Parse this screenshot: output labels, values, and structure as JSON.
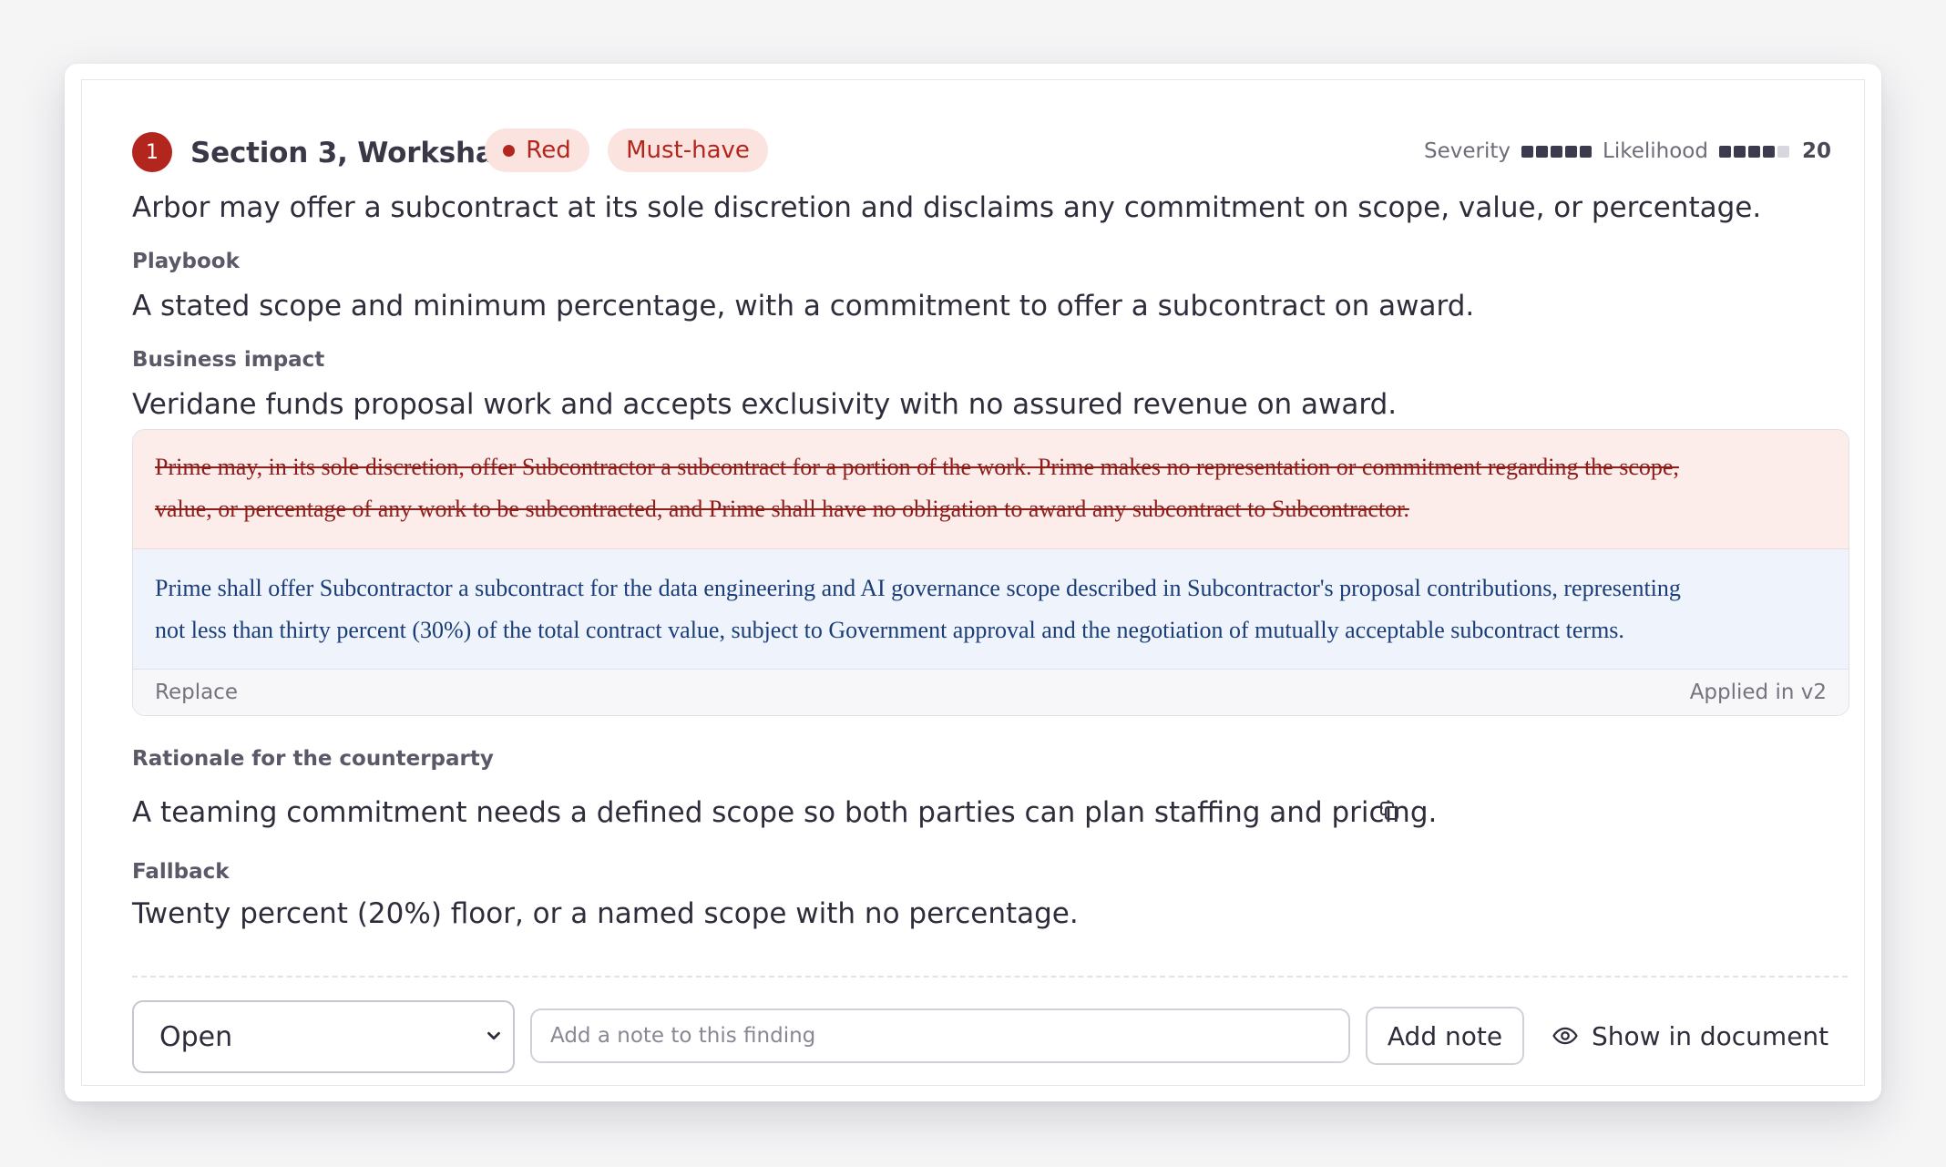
{
  "finding": {
    "number": "1",
    "title": "Section 3, Workshare",
    "rag_label": "Red",
    "priority_label": "Must-have",
    "severity_label": "Severity",
    "severity_level": 5,
    "likelihood_label": "Likelihood",
    "likelihood_level": 4,
    "score": "20",
    "summary": "Arbor may offer a subcontract at its sole discretion and disclaims any commitment on scope, value, or percentage."
  },
  "playbook": {
    "label": "Playbook",
    "text": "A stated scope and minimum percentage, with a commitment to offer a subcontract on award."
  },
  "impact": {
    "label": "Business impact",
    "text": "Veridane funds proposal work and accepts exclusivity with no assured revenue on award."
  },
  "redline": {
    "deleted_line1": "Prime may, in its sole discretion, offer Subcontractor a subcontract for a portion of the work. Prime makes no representation or commitment regarding the scope,",
    "deleted_line2": "value, or percentage of any work to be subcontracted, and Prime shall have no obligation to award any subcontract to Subcontractor.",
    "inserted_line1": "Prime shall offer Subcontractor a subcontract for the data engineering and AI governance scope described in Subcontractor's proposal contributions, representing",
    "inserted_line2": "not less than thirty percent (30%) of the total contract value, subject to Government approval and the negotiation of mutually acceptable subcontract terms.",
    "action": "Replace",
    "status": "Applied in v2"
  },
  "rationale": {
    "label": "Rationale for the counterparty",
    "text": "A teaming commitment needs a defined scope so both parties can plan staffing and pricing."
  },
  "fallback": {
    "label": "Fallback",
    "text": "Twenty percent (20%) floor, or a named scope with no percentage."
  },
  "footer": {
    "status_value": "Open",
    "note_placeholder": "Add a note to this finding",
    "add_note_label": "Add note",
    "show_label": "Show in document"
  },
  "colors": {
    "accent_red": "#b3261e",
    "pill_bg": "#fbe3df",
    "deleted_text": "#8e1d1a",
    "inserted_text": "#1a3d78"
  },
  "icons": [
    "copy-icon",
    "eye-icon",
    "chevron-down-icon"
  ]
}
